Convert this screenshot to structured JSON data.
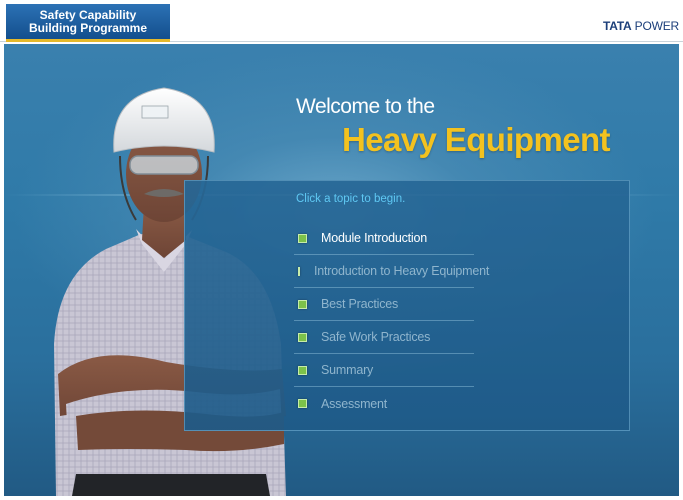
{
  "header": {
    "programme_line1": "Safety Capability",
    "programme_line2": "Building Programme",
    "brand_bold": "TATA",
    "brand_rest": " POWER"
  },
  "hero": {
    "welcome": "Welcome to the",
    "title": "Heavy Equipment"
  },
  "menu": {
    "hint": "Click a topic to begin.",
    "items": [
      {
        "label": "Module Introduction",
        "active": true
      },
      {
        "label": "Introduction to Heavy Equipment",
        "active": false
      },
      {
        "label": "Best Practices",
        "active": false
      },
      {
        "label": "Safe Work Practices",
        "active": false
      },
      {
        "label": "Summary",
        "active": false
      },
      {
        "label": "Assessment",
        "active": false
      }
    ]
  },
  "colors": {
    "accent_yellow": "#f3c21f",
    "bullet_green": "#7cc24a",
    "hint_cyan": "#5fc8f3",
    "badge_blue": "#1c5a99"
  },
  "icons": {
    "bullet": "square-bullet-icon"
  }
}
